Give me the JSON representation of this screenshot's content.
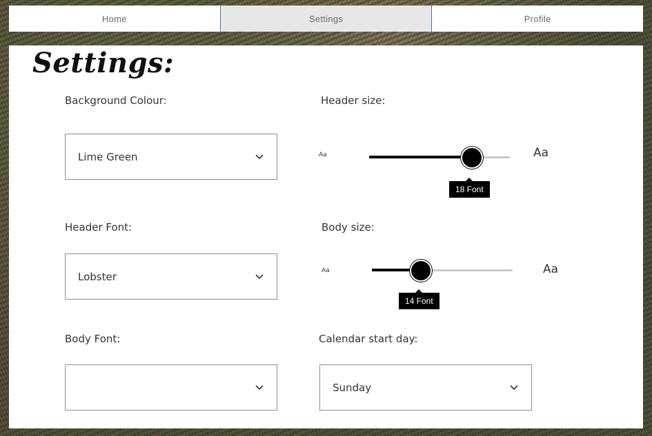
{
  "nav": {
    "tabs": [
      {
        "label": "Home"
      },
      {
        "label": "Settings"
      },
      {
        "label": "Profile"
      }
    ],
    "active_tab": "Settings"
  },
  "page": {
    "title": "Settings:"
  },
  "settings": {
    "background_colour": {
      "label": "Background Colour:",
      "value": "Lime Green"
    },
    "header_font": {
      "label": "Header Font:",
      "value": "Lobster"
    },
    "body_font": {
      "label": "Body Font:",
      "value": ""
    },
    "header_size": {
      "label": "Header size:",
      "min_label": "Aa",
      "max_label": "Aa",
      "tooltip": "18 Font",
      "value_fraction": 0.73
    },
    "body_size": {
      "label": "Body size:",
      "min_label": "Aa",
      "max_label": "Aa",
      "tooltip": "14 Font",
      "value_fraction": 0.35
    },
    "calendar_start_day": {
      "label": "Calendar start day:",
      "value": "Sunday"
    }
  },
  "icons": {
    "dropdown": "chevron-down-icon"
  },
  "colors": {
    "active_tab_bg": "#e8e7e7",
    "active_tab_border": "#3a76c4",
    "slider_fill": "#000000",
    "slider_track": "#c9c9c9"
  }
}
